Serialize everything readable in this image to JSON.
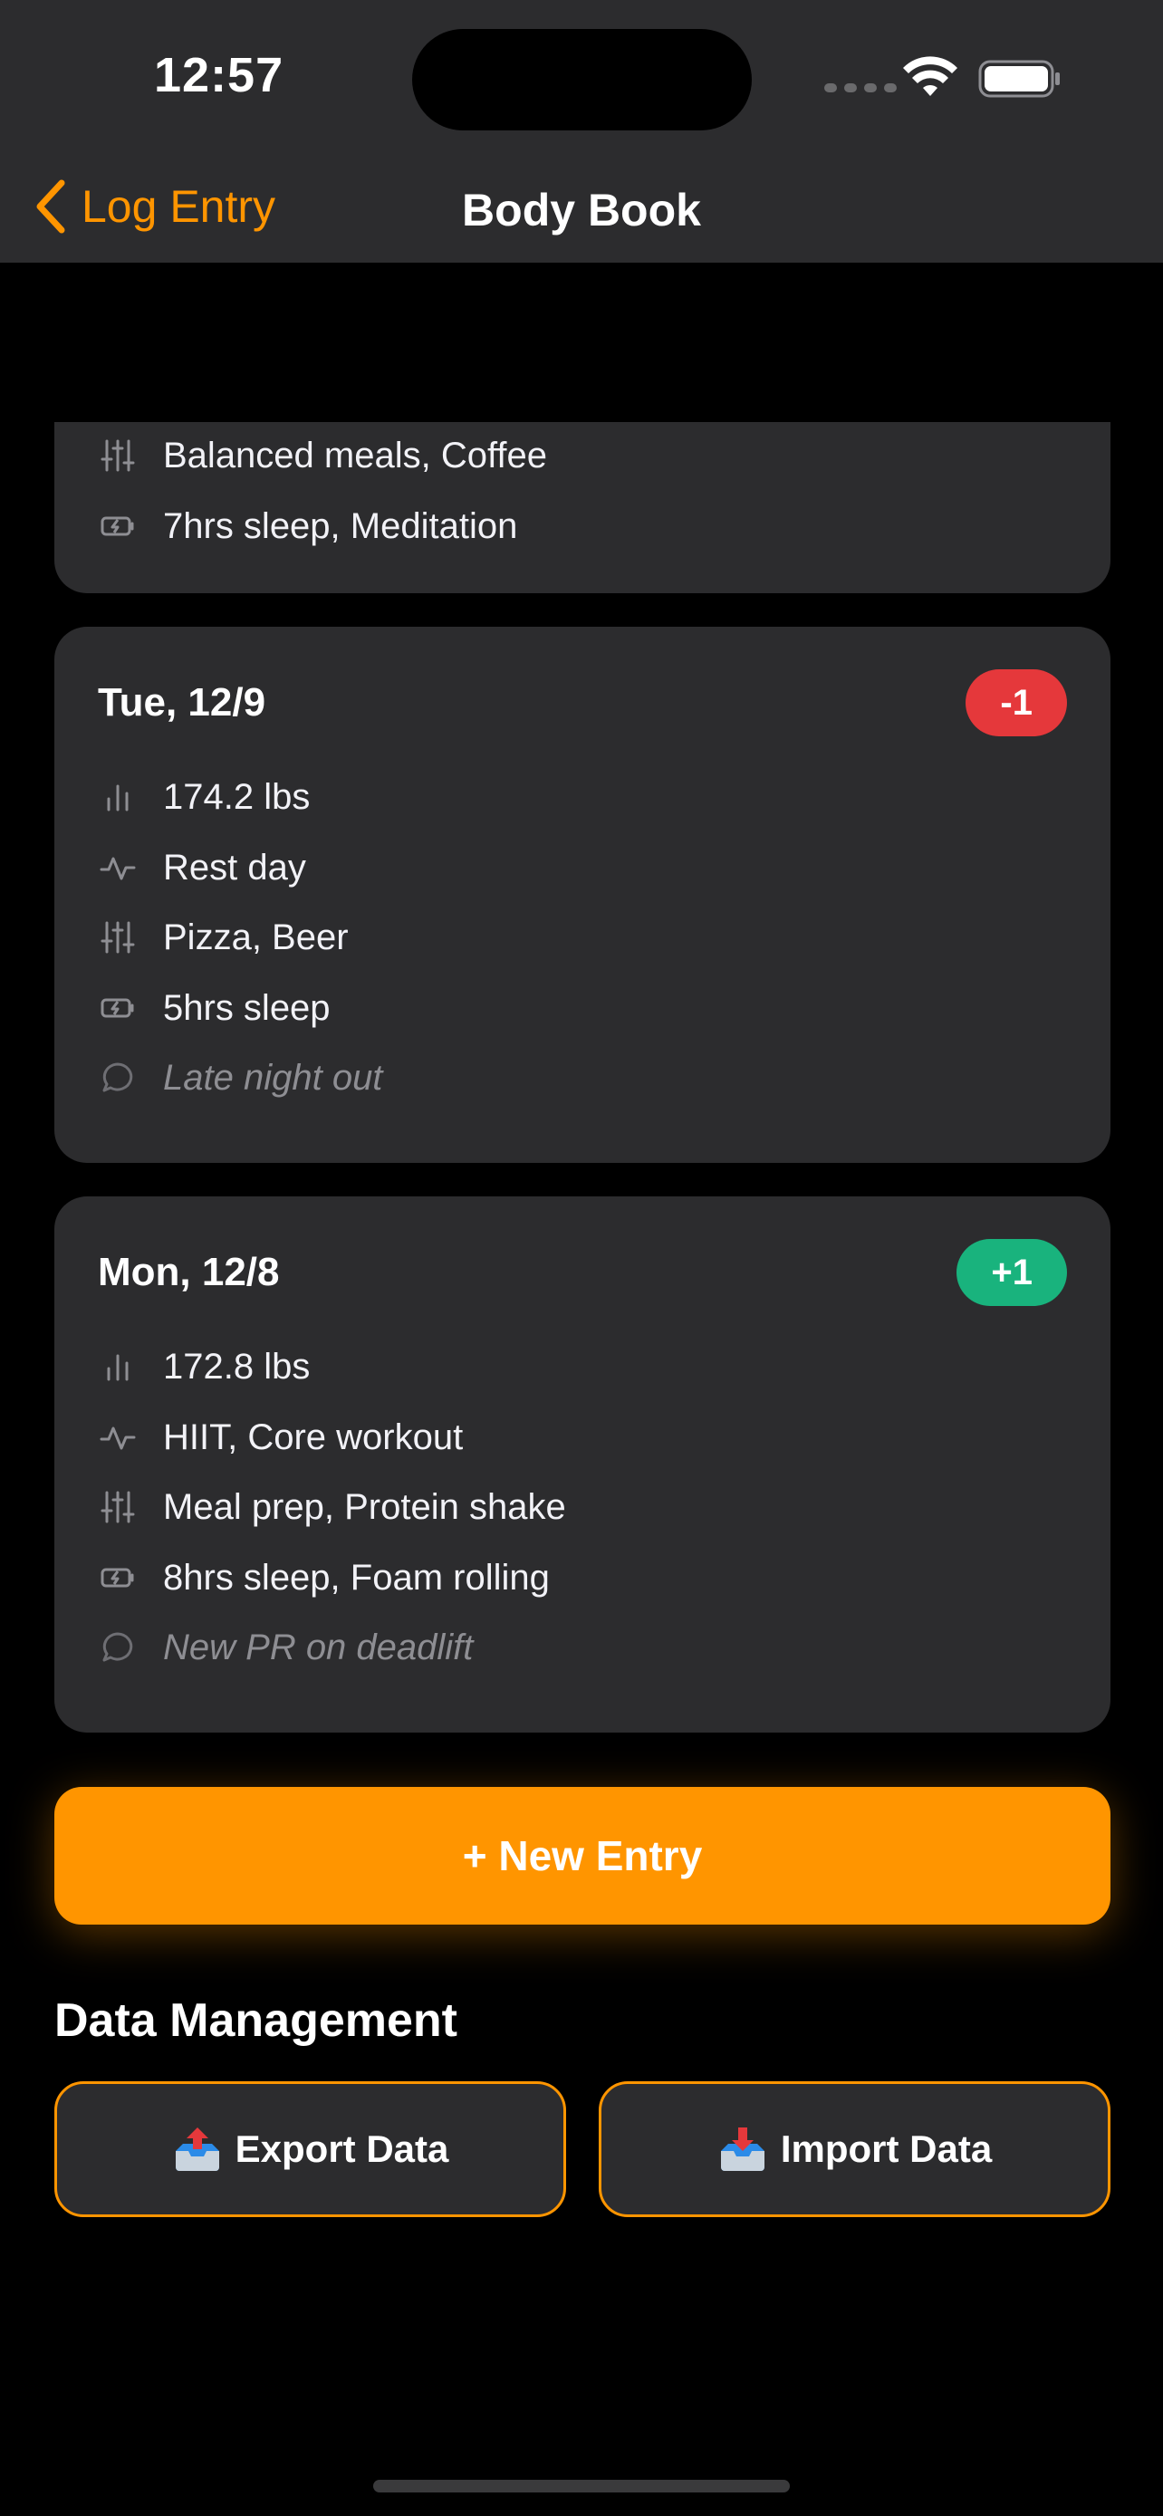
{
  "status_bar": {
    "time": "12:57"
  },
  "nav": {
    "back_label": "Log Entry",
    "title": "Body Book"
  },
  "partial_card": {
    "rows": [
      {
        "icon": "sliders-icon",
        "text": "Balanced meals, Coffee"
      },
      {
        "icon": "battery-charging-icon",
        "text": "7hrs sleep, Meditation"
      }
    ]
  },
  "entries": [
    {
      "date": "Tue, 12/9",
      "badge": "-1",
      "weight": "174.2 lbs",
      "activity": "Rest day",
      "food": "Pizza, Beer",
      "recovery": "5hrs sleep",
      "note": "Late night out"
    },
    {
      "date": "Mon, 12/8",
      "badge": "+1",
      "weight": "172.8 lbs",
      "activity": "HIIT, Core workout",
      "food": "Meal prep, Protein shake",
      "recovery": "8hrs sleep, Foam rolling",
      "note": "New PR on deadlift"
    }
  ],
  "new_entry_label": "+ New Entry",
  "data_management": {
    "title": "Data Management",
    "export_label": "Export Data",
    "import_label": "Import Data"
  },
  "colors": {
    "accent": "#ff9500",
    "card": "#2c2c2e",
    "badge_negative": "#e5383b",
    "badge_positive": "#19b37d"
  }
}
